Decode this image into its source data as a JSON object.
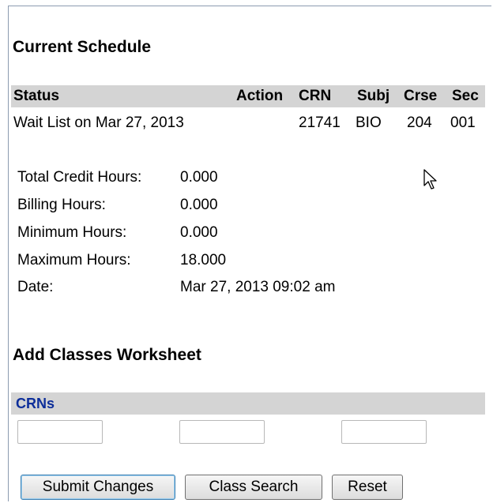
{
  "current_schedule": {
    "title": "Current Schedule",
    "headers": {
      "status": "Status",
      "action": "Action",
      "crn": "CRN",
      "subj": "Subj",
      "crse": "Crse",
      "sec": "Sec"
    },
    "rows": [
      {
        "status": "Wait List on Mar 27, 2013",
        "action": "",
        "crn": "21741",
        "subj": "BIO",
        "crse": "204",
        "sec": "001"
      }
    ]
  },
  "summary": {
    "total_credit_hours": {
      "label": "Total Credit Hours:",
      "value": "0.000"
    },
    "billing_hours": {
      "label": "Billing Hours:",
      "value": "0.000"
    },
    "minimum_hours": {
      "label": "Minimum Hours:",
      "value": "0.000"
    },
    "maximum_hours": {
      "label": "Maximum Hours:",
      "value": "18.000"
    },
    "date": {
      "label": "Date:",
      "value": "Mar 27, 2013 09:02 am"
    }
  },
  "worksheet": {
    "title": "Add Classes Worksheet",
    "crns_label": "CRNs",
    "crn_inputs": [
      "",
      "",
      ""
    ]
  },
  "buttons": {
    "submit": "Submit Changes",
    "class_search": "Class Search",
    "reset": "Reset"
  },
  "colors": {
    "header_band": "#d4d4d4",
    "crns_label": "#0d2e9a",
    "frame_border": "#8c9bb0"
  },
  "icons": {
    "cursor": "mouse-pointer-icon"
  }
}
